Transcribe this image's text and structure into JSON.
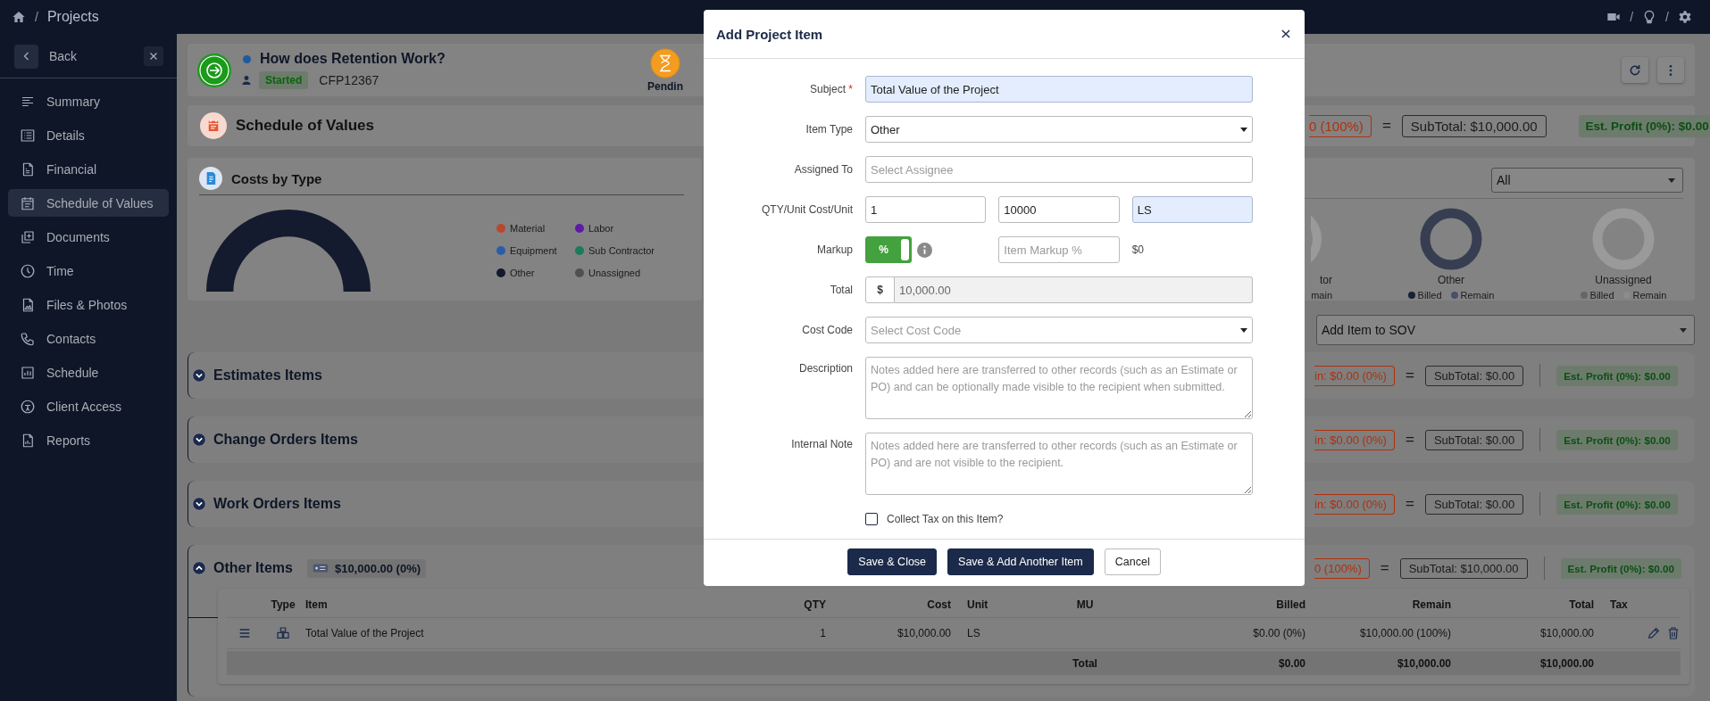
{
  "top_bar": {
    "separator": "/",
    "title": "Projects",
    "icon_separators": [
      "/",
      "/"
    ]
  },
  "sidebar": {
    "back": "Back",
    "items": [
      {
        "label": "Summary",
        "selected": false
      },
      {
        "label": "Details",
        "selected": false
      },
      {
        "label": "Financial",
        "selected": false
      },
      {
        "label": "Schedule of Values",
        "selected": true
      },
      {
        "label": "Documents",
        "selected": false
      },
      {
        "label": "Time",
        "selected": false
      },
      {
        "label": "Files & Photos",
        "selected": false
      },
      {
        "label": "Contacts",
        "selected": false
      },
      {
        "label": "Schedule",
        "selected": false
      },
      {
        "label": "Client Access",
        "selected": false
      },
      {
        "label": "Reports",
        "selected": false
      }
    ]
  },
  "project": {
    "title": "How does Retention Work?",
    "status": "Started",
    "code": "CFP12367",
    "stage": "Pendin"
  },
  "sov": {
    "title": "Schedule of Values",
    "totals": {
      "retention": "0 (100%)",
      "equals": "=",
      "subtotal": "SubTotal: $10,000.00",
      "profit": "Est. Profit (0%): $0.00"
    }
  },
  "costs_by_type": {
    "title": "Costs by Type",
    "legend": [
      {
        "label": "Material",
        "color": "#b9482c"
      },
      {
        "label": "Labor",
        "color": "#5e1aa6"
      },
      {
        "label": "Equipment",
        "color": "#2a5ca8"
      },
      {
        "label": "Sub Contractor",
        "color": "#1d7a5b"
      },
      {
        "label": "Other",
        "color": "#131a2e"
      },
      {
        "label": "Unassigned",
        "color": "#505050"
      }
    ]
  },
  "billing": {
    "filter": "All",
    "donuts": [
      {
        "kind": "cut",
        "label": "tor",
        "color": "#9a9a9a",
        "legend": [
          {
            "label": "main"
          }
        ]
      },
      {
        "kind": "full",
        "label": "Other",
        "color": "#383e52",
        "legend": [
          {
            "label": "Billed",
            "color": "#1a2036"
          },
          {
            "label": "Remain",
            "color": "#4a5068"
          }
        ]
      },
      {
        "kind": "full",
        "label": "Unassigned",
        "color": "#9a9a9a",
        "legend": [
          {
            "label": "Billed",
            "color": "#666666"
          },
          {
            "label": "Remain",
            "color": "#8c8c8c"
          }
        ]
      }
    ]
  },
  "add_item": "Add Item to SOV",
  "sections": [
    {
      "title": "Estimates Items",
      "expanded": false,
      "totals": {
        "retention": "in: $0.00 (0%)",
        "equals": "=",
        "subtotal": "SubTotal: $0.00",
        "profit": "Est. Profit (0%): $0.00"
      }
    },
    {
      "title": "Change Orders Items",
      "expanded": false,
      "totals": {
        "retention": "in: $0.00 (0%)",
        "equals": "=",
        "subtotal": "SubTotal: $0.00",
        "profit": "Est. Profit (0%): $0.00"
      }
    },
    {
      "title": "Work Orders Items",
      "expanded": false,
      "totals": {
        "retention": "in: $0.00 (0%)",
        "equals": "=",
        "subtotal": "SubTotal: $0.00",
        "profit": "Est. Profit (0%): $0.00"
      }
    },
    {
      "title": "Other Items",
      "expanded": true,
      "amount": "$10,000.00 (0%)",
      "totals": {
        "retention": "0 (100%)",
        "equals": "=",
        "subtotal": "SubTotal: $10,000.00",
        "profit": "Est. Profit (0%): $0.00"
      },
      "table": {
        "columns": [
          "Type",
          "Item",
          "QTY",
          "Cost",
          "Unit",
          "MU",
          "Billed",
          "Remain",
          "Total",
          "Tax"
        ],
        "rows": [
          {
            "item": "Total Value of the Project",
            "qty": "1",
            "cost": "$10,000.00",
            "unit": "LS",
            "billed": "$0.00 (0%)",
            "remain": "$10,000.00 (100%)",
            "total": "$10,000.00"
          }
        ],
        "footer": {
          "label": "Total",
          "billed": "$0.00",
          "remain": "$10,000.00",
          "total": "$10,000.00"
        }
      }
    }
  ],
  "modal": {
    "title": "Add Project Item",
    "subject": {
      "label": "Subject",
      "required_mark": "*",
      "value": "Total Value of the Project",
      "autofilled": true
    },
    "item_type": {
      "label": "Item Type",
      "value": "Other"
    },
    "assigned_to": {
      "label": "Assigned To",
      "placeholder": "Select Assignee"
    },
    "qty_cost_unit": {
      "label": "QTY/Unit Cost/Unit",
      "fields": [
        {
          "value": "1",
          "autofilled": false
        },
        {
          "value": "10000",
          "autofilled": false
        },
        {
          "value": "LS",
          "autofilled": true
        }
      ]
    },
    "markup": {
      "label": "Markup",
      "toggle_label": "%",
      "on": true,
      "placeholder": "Item Markup %",
      "amount": "$0"
    },
    "total": {
      "label": "Total",
      "prefix": "$",
      "value": "10,000.00",
      "disabled": true
    },
    "cost_code": {
      "label": "Cost Code",
      "placeholder": "Select Cost Code"
    },
    "description": {
      "label": "Description",
      "placeholder": "Notes added here are transferred to other records (such as an Estimate or PO) and can be optionally made visible to the recipient when submitted."
    },
    "internal_note": {
      "label": "Internal Note",
      "placeholder": "Notes added here are transferred to other records (such as an Estimate or PO) and are not visible to the recipient."
    },
    "collect_tax": {
      "label": "Collect Tax on this Item?",
      "checked": false
    },
    "buttons": [
      {
        "label": "Save & Close",
        "kind": "primary"
      },
      {
        "label": "Save & Add Another Item",
        "kind": "primary"
      },
      {
        "label": "Cancel",
        "kind": "secondary"
      }
    ]
  }
}
